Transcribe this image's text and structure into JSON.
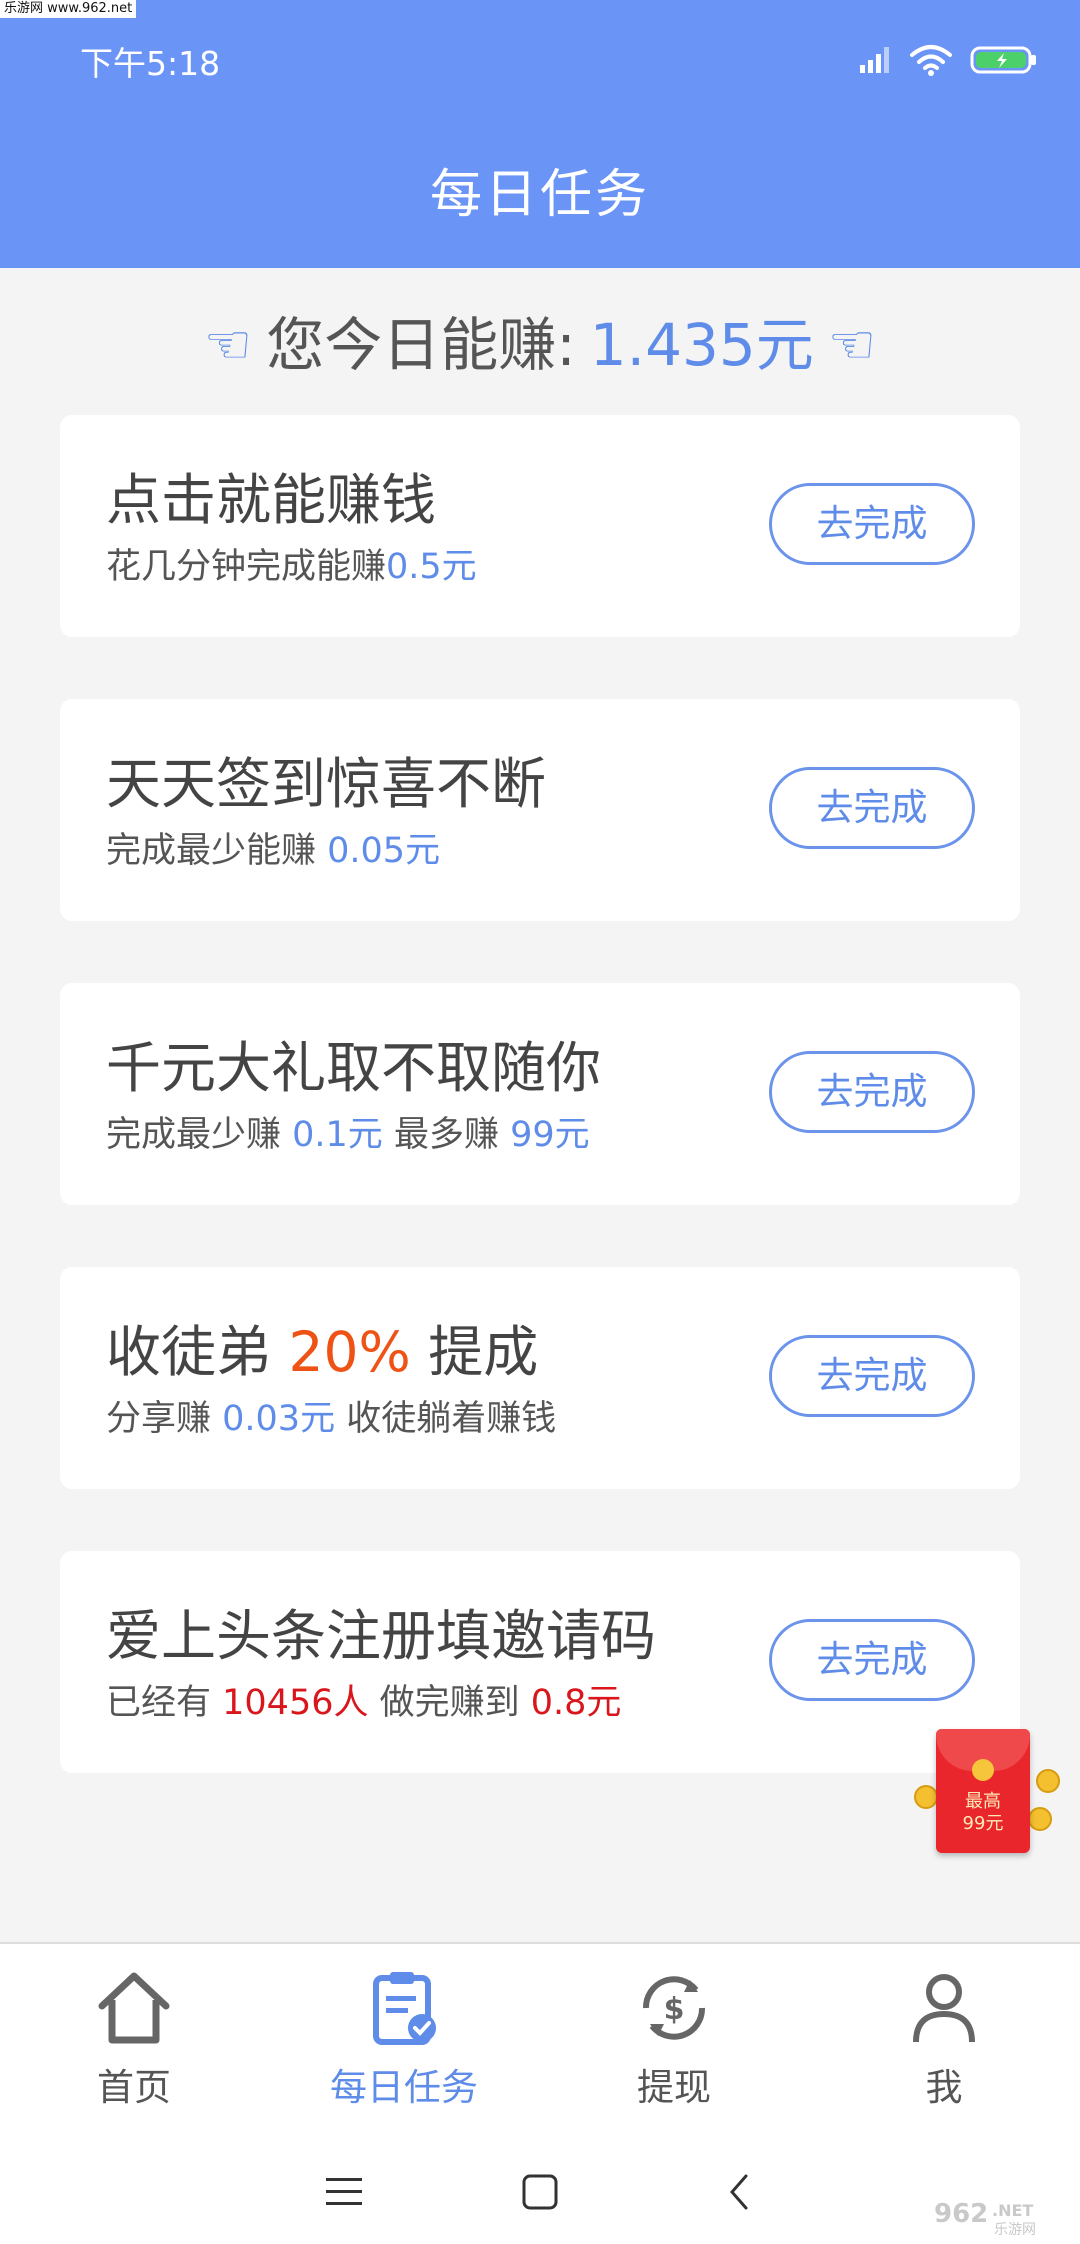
{
  "watermark_top": "乐游网 www.962.net",
  "status_bar": {
    "time": "下午5:18"
  },
  "header": {
    "title": "每日任务"
  },
  "summary": {
    "label": "您今日能赚:",
    "amount": "1.435元",
    "hand": "☜"
  },
  "tasks": [
    {
      "title": "点击就能赚钱",
      "desc_a": "花几分钟完成能赚",
      "desc_b": "0.5元",
      "button": "去完成"
    },
    {
      "title": "天天签到惊喜不断",
      "desc_a": "完成最少能赚 ",
      "desc_b": "0.05元",
      "button": "去完成"
    },
    {
      "title": "千元大礼取不取随你",
      "desc_a": "完成最少赚 ",
      "desc_b": "0.1元",
      "desc_c": " 最多赚 ",
      "desc_d": "99元",
      "button": "去完成"
    },
    {
      "title_a": "收徒弟 ",
      "title_b": "20%",
      "title_c": " 提成",
      "desc_a": "分享赚 ",
      "desc_b": "0.03元",
      "desc_c": " 收徒躺着赚钱",
      "button": "去完成"
    },
    {
      "title": "爱上头条注册填邀请码",
      "desc_a": "已经有 ",
      "desc_b": "10456人",
      "desc_c": " 做完赚到 ",
      "desc_d": "0.8元",
      "button": "去完成"
    }
  ],
  "red_packet": {
    "line1": "最高",
    "line2": "99元"
  },
  "bottom_nav": [
    {
      "label": "首页",
      "icon": "home-icon"
    },
    {
      "label": "每日任务",
      "icon": "clipboard-icon",
      "active": true
    },
    {
      "label": "提现",
      "icon": "withdraw-icon"
    },
    {
      "label": "我",
      "icon": "person-icon"
    }
  ],
  "system_nav": [
    "menu-icon",
    "home-square-icon",
    "back-icon"
  ],
  "watermark_bottom": {
    "a": "962",
    "b": ".NET",
    "c": "乐游网"
  },
  "colors": {
    "header": "#6a94f5",
    "accent": "#5e8ce8",
    "red": "#d9161b",
    "orange": "#ee5215"
  }
}
